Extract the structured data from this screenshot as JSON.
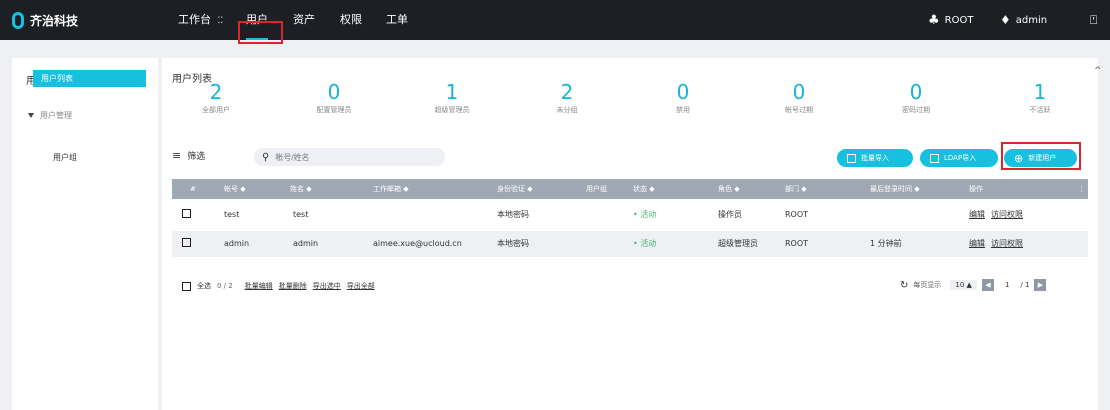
{
  "brand": {
    "name": "齐治科技"
  },
  "nav": {
    "workbench": "工作台",
    "users": "用户",
    "assets": "资产",
    "permissions": "权限",
    "tickets": "工单"
  },
  "topright": {
    "org": "ROOT",
    "user": "admin"
  },
  "sidebar": {
    "title": "用户",
    "group": "用户管理",
    "items": [
      "用户列表",
      "用户组"
    ]
  },
  "main": {
    "title": "用户列表",
    "stats": [
      {
        "value": "2",
        "label": "全部用户"
      },
      {
        "value": "0",
        "label": "配置管理员"
      },
      {
        "value": "1",
        "label": "超级管理员"
      },
      {
        "value": "2",
        "label": "未分组"
      },
      {
        "value": "0",
        "label": "禁用"
      },
      {
        "value": "0",
        "label": "帐号过期"
      },
      {
        "value": "0",
        "label": "密码过期"
      },
      {
        "value": "1",
        "label": "不活跃"
      }
    ],
    "filter_label": "筛选",
    "search_placeholder": "帐号/姓名",
    "actions": {
      "batch_import": "批量导入",
      "ldap_import": "LDAP导入",
      "new_user": "新建用户"
    },
    "table": {
      "headers": {
        "num": "#",
        "account": "帐号 ◆",
        "name": "姓名 ◆",
        "email": "工作邮箱 ◆",
        "auth": "身份验证 ◆",
        "group": "用户组",
        "status": "状态 ◆",
        "role": "角色 ◆",
        "dept": "部门 ◆",
        "last_login": "最后登录时间 ◆",
        "ops": "操作"
      },
      "rows": [
        {
          "account": "test",
          "name": "test",
          "email": "",
          "auth": "本地密码",
          "status": "• 活动",
          "role": "操作员",
          "dept": "ROOT",
          "last_login": "",
          "edit": "编辑",
          "access": "访问权限"
        },
        {
          "account": "admin",
          "name": "admin",
          "email": "aimee.xue@ucloud.cn",
          "auth": "本地密码",
          "status": "• 活动",
          "role": "超级管理员",
          "dept": "ROOT",
          "last_login": "1 分钟前",
          "edit": "编辑",
          "access": "访问权限"
        }
      ]
    },
    "footer": {
      "select_all": "全选",
      "count": "0 / 2",
      "batch_edit": "批量编辑",
      "batch_delete": "批量删除",
      "export_selected": "导出选中",
      "export_all": "导出全部",
      "per_page_label": "每页显示",
      "per_page": "10",
      "page": "1",
      "total_pages": "/ 1"
    }
  },
  "colors": {
    "accent": "#18c0e0",
    "highlight": "#d9262c",
    "topbar": "#1c1f24"
  }
}
